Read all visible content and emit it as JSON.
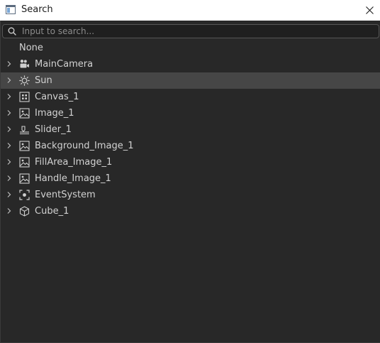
{
  "window": {
    "title": "Search"
  },
  "search": {
    "placeholder": "Input to search...",
    "value": ""
  },
  "tree": {
    "none_label": "None",
    "items": [
      {
        "label": "MainCamera",
        "icon": "camera-icon",
        "selected": false
      },
      {
        "label": "Sun",
        "icon": "sun-icon",
        "selected": true
      },
      {
        "label": "Canvas_1",
        "icon": "canvas-icon",
        "selected": false
      },
      {
        "label": "Image_1",
        "icon": "image-icon",
        "selected": false
      },
      {
        "label": "Slider_1",
        "icon": "slider-icon",
        "selected": false
      },
      {
        "label": "Background_Image_1",
        "icon": "image-icon",
        "selected": false
      },
      {
        "label": "FillArea_Image_1",
        "icon": "image-icon",
        "selected": false
      },
      {
        "label": "Handle_Image_1",
        "icon": "image-icon",
        "selected": false
      },
      {
        "label": "EventSystem",
        "icon": "event-system-icon",
        "selected": false
      },
      {
        "label": "Cube_1",
        "icon": "cube-icon",
        "selected": false
      }
    ]
  },
  "colors": {
    "background": "#282828",
    "selected_row": "#464646",
    "text": "#d2d2d2",
    "placeholder": "#8c8c8c"
  }
}
